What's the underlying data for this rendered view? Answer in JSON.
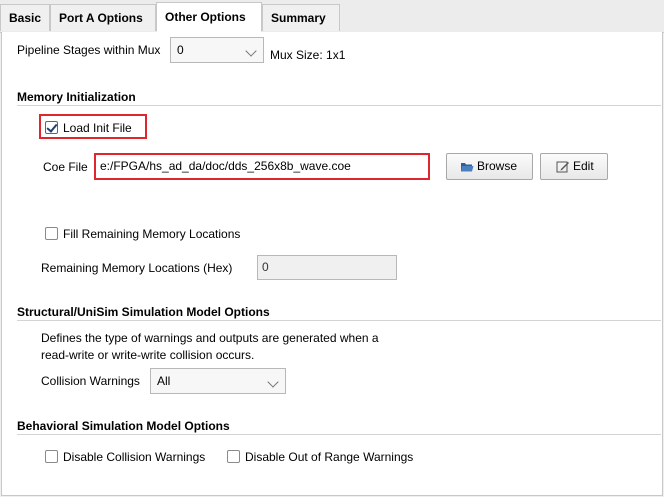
{
  "tabs": [
    "Basic",
    "Port A Options",
    "Other Options",
    "Summary"
  ],
  "active_tab": "Other Options",
  "pipeline": {
    "label": "Pipeline Stages within Mux",
    "value": "0",
    "mux_size": "Mux Size: 1x1"
  },
  "memory_init": {
    "title": "Memory Initialization",
    "load_init_label": "Load Init File",
    "load_init_checked": true,
    "coe_label": "Coe File",
    "coe_value": "e:/FPGA/hs_ad_da/doc/dds_256x8b_wave.coe",
    "browse_label": "Browse",
    "edit_label": "Edit",
    "fill_label": "Fill Remaining Memory Locations",
    "fill_checked": false,
    "remaining_label": "Remaining Memory Locations (Hex)",
    "remaining_value": "0"
  },
  "structural": {
    "title": "Structural/UniSim Simulation Model Options",
    "desc_line1": "Defines the type of warnings and outputs are generated when a",
    "desc_line2": "read-write or write-write collision occurs.",
    "collision_label": "Collision Warnings",
    "collision_value": "All"
  },
  "behavioral": {
    "title": "Behavioral Simulation Model Options",
    "disable_collision_label": "Disable Collision Warnings",
    "disable_range_label": "Disable Out of Range Warnings"
  },
  "highlight_color": "#e0262d"
}
